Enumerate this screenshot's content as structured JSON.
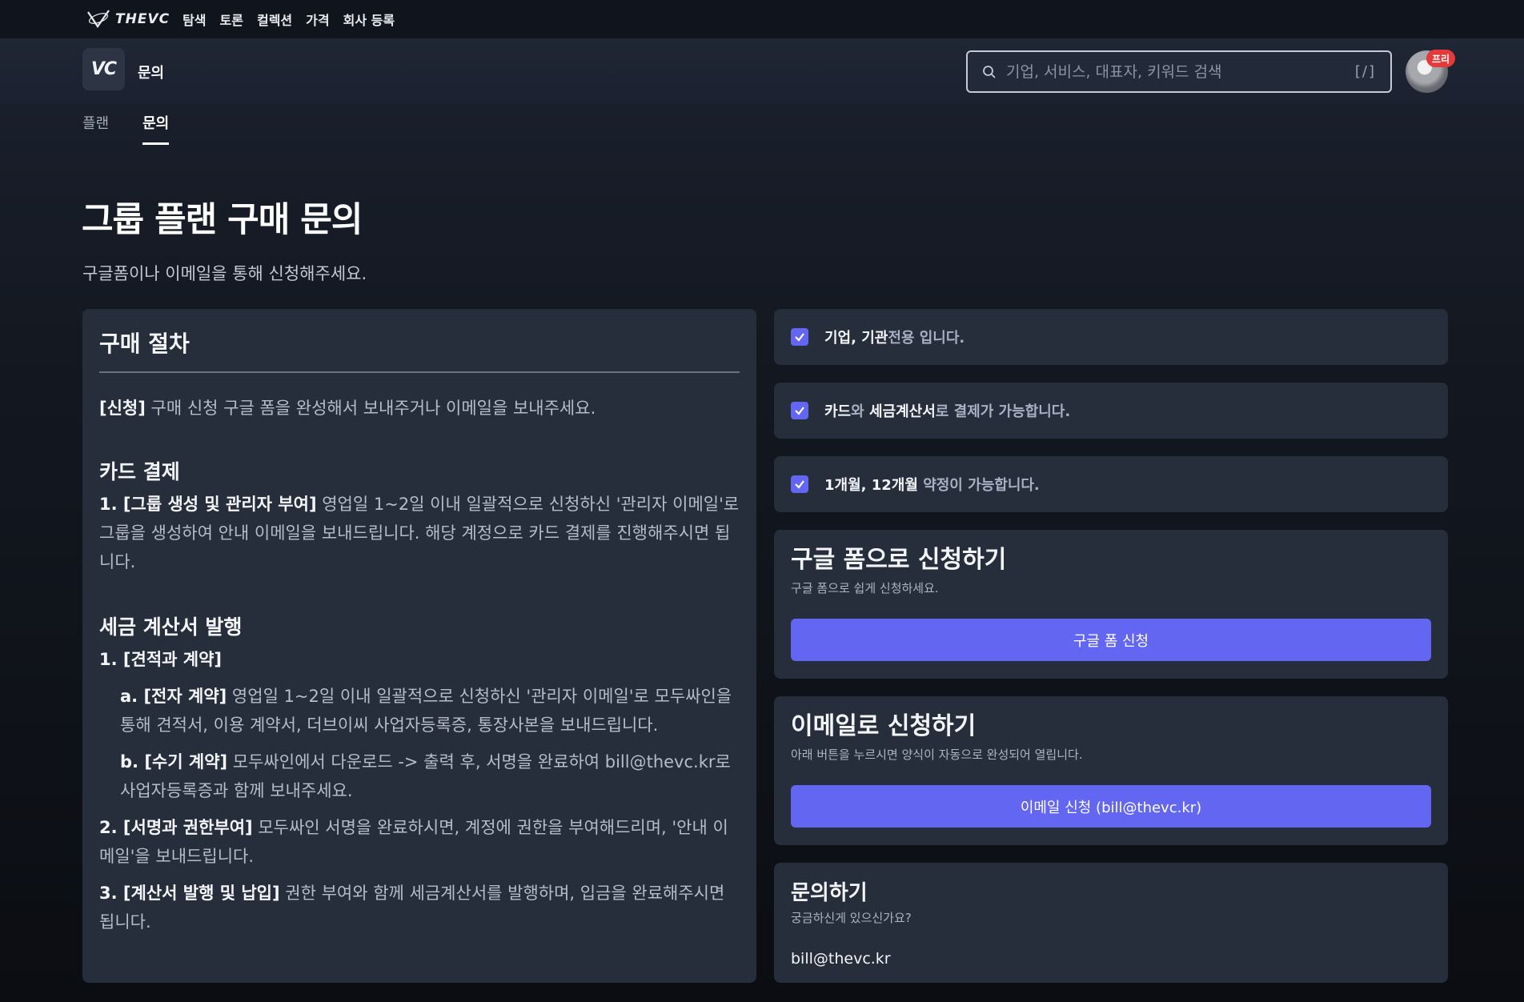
{
  "topbar": {
    "brand": "THEVC",
    "nav": [
      "탐색",
      "토론",
      "컬렉션",
      "가격",
      "회사 등록"
    ]
  },
  "header": {
    "logo_text": "VC",
    "page_label": "문의",
    "search_placeholder": "기업, 서비스, 대표자, 키워드 검색",
    "search_shortcut": "[/]",
    "avatar_badge": "프리"
  },
  "tabs": [
    {
      "label": "플랜",
      "active": false
    },
    {
      "label": "문의",
      "active": true
    }
  ],
  "main": {
    "title": "그룹 플랜 구매 문의",
    "subtitle": "구글폼이나 이메일을 통해 신청해주세요."
  },
  "procedure": {
    "title": "구매 절차",
    "apply_tag": "[신청]",
    "apply_text": " 구매 신청 구글 폼을 완성해서 보내주거나 이메일을 보내주세요.",
    "card_heading": "카드 결제",
    "card_step_tag": "1. [그룹 생성 및 관리자 부여]",
    "card_step_text": " 영업일 1~2일 이내 일괄적으로 신청하신 '관리자 이메일'로 그룹을 생성하여 안내 이메일을 보내드립니다. 해당 계정으로 카드 결제를 진행해주시면 됩니다.",
    "tax_heading": "세금 계산서 발행",
    "tax_step1_tag": "1. [견적과 계약]",
    "tax_step1a_tag": "a. [전자 계약]",
    "tax_step1a_text": " 영업일 1~2일 이내 일괄적으로 신청하신 '관리자 이메일'로 모두싸인을 통해 견적서, 이용 계약서, 더브이씨 사업자등록증, 통장사본을 보내드립니다.",
    "tax_step1b_tag": "b. [수기 계약]",
    "tax_step1b_text": " 모두싸인에서 다운로드 -> 출력 후, 서명을 완료하여 bill@thevc.kr로 사업자등록증과 함께 보내주세요.",
    "tax_step2_tag": "2. [서명과 권한부여]",
    "tax_step2_text": " 모두싸인 서명을 완료하시면, 계정에 권한을 부여해드리며, '안내 이메일'을 보내드립니다.",
    "tax_step3_tag": "3. [계산서 발행 및 납입]",
    "tax_step3_text": " 권한 부여와 함께 세금계산서를 발행하며, 입금을 완료해주시면 됩니다."
  },
  "checks": [
    {
      "parts": [
        {
          "t": "기업, 기관",
          "strong": true
        },
        {
          "t": "전용 입니다.",
          "strong": false
        }
      ]
    },
    {
      "parts": [
        {
          "t": "카드",
          "strong": true
        },
        {
          "t": "와 ",
          "strong": false
        },
        {
          "t": "세금계산서",
          "strong": true
        },
        {
          "t": "로 결제가 가능합니다.",
          "strong": false
        }
      ]
    },
    {
      "parts": [
        {
          "t": "1개월, 12개월",
          "strong": true
        },
        {
          "t": " 약정이 가능합니다.",
          "strong": false
        }
      ]
    }
  ],
  "google_form": {
    "title": "구글 폼으로 신청하기",
    "subtitle": "구글 폼으로 쉽게 신청하세요.",
    "button": "구글 폼 신청"
  },
  "email_apply": {
    "title": "이메일로 신청하기",
    "subtitle": "아래 버튼을 누르시면 양식이 자동으로 완성되어 열립니다.",
    "button": "이메일 신청 (bill@thevc.kr)"
  },
  "contact": {
    "title": "문의하기",
    "subtitle": "궁금하신게 있으신가요?",
    "email": "bill@thevc.kr"
  },
  "colors": {
    "accent": "#6366f1",
    "card_bg": "#262d3b",
    "badge": "#e53a3a"
  }
}
